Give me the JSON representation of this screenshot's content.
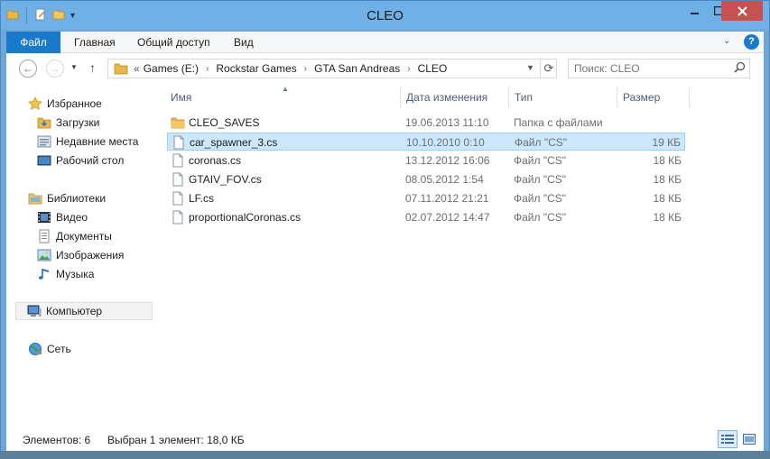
{
  "window": {
    "title": "CLEO"
  },
  "ribbon": {
    "tabs": [
      {
        "label": "Файл"
      },
      {
        "label": "Главная"
      },
      {
        "label": "Общий доступ"
      },
      {
        "label": "Вид"
      }
    ],
    "help_label": "?"
  },
  "address": {
    "breadcrumbs": [
      "Games (E:)",
      "Rockstar Games",
      "GTA San Andreas",
      "CLEO"
    ]
  },
  "search": {
    "placeholder": "Поиск: CLEO"
  },
  "sidebar": {
    "favorites": {
      "label": "Избранное",
      "items": [
        "Загрузки",
        "Недавние места",
        "Рабочий стол"
      ]
    },
    "libraries": {
      "label": "Библиотеки",
      "items": [
        "Видео",
        "Документы",
        "Изображения",
        "Музыка"
      ]
    },
    "computer": "Компьютер",
    "network": "Сеть"
  },
  "columns": {
    "name": "Имя",
    "date": "Дата изменения",
    "type": "Тип",
    "size": "Размер"
  },
  "files": [
    {
      "name": "CLEO_SAVES",
      "date": "19.06.2013 11:10",
      "type": "Папка с файлами",
      "size": "",
      "kind": "folder"
    },
    {
      "name": "car_spawner_3.cs",
      "date": "10.10.2010 0:10",
      "type": "Файл \"CS\"",
      "size": "19 КБ",
      "kind": "file"
    },
    {
      "name": "coronas.cs",
      "date": "13.12.2012 16:06",
      "type": "Файл \"CS\"",
      "size": "18 КБ",
      "kind": "file"
    },
    {
      "name": "GTAIV_FOV.cs",
      "date": "08.05.2012 1:54",
      "type": "Файл \"CS\"",
      "size": "18 КБ",
      "kind": "file"
    },
    {
      "name": "LF.cs",
      "date": "07.11.2012 21:21",
      "type": "Файл \"CS\"",
      "size": "18 КБ",
      "kind": "file"
    },
    {
      "name": "proportionalCoronas.cs",
      "date": "02.07.2012 14:47",
      "type": "Файл \"CS\"",
      "size": "18 КБ",
      "kind": "file"
    }
  ],
  "status": {
    "count": "Элементов: 6",
    "selection": "Выбран 1 элемент: 18,0 КБ"
  },
  "colors": {
    "accent": "#1979ca",
    "selection_bg": "#cce8ff",
    "selection_border": "#99d1ff",
    "titlebar": "#6fb0e6",
    "close": "#c75050"
  }
}
